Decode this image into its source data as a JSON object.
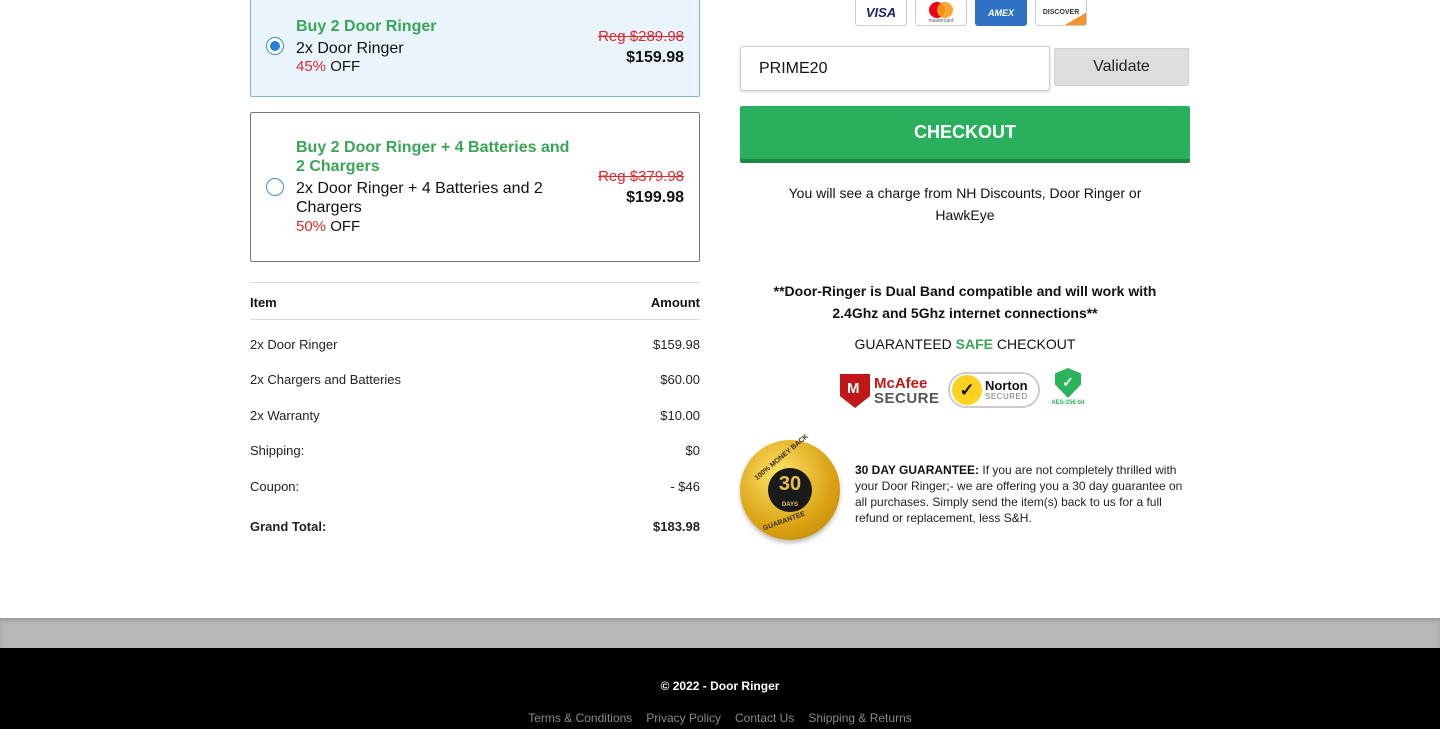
{
  "offers": [
    {
      "title": "Buy 2 Door Ringer",
      "subtitle": "2x Door Ringer",
      "discount_pct": "45%",
      "discount_word": " OFF",
      "reg_price": "Reg $289.98",
      "price": "$159.98",
      "selected": true
    },
    {
      "title": "Buy 2 Door Ringer + 4 Batteries and 2 Chargers",
      "subtitle": "2x Door Ringer + 4 Batteries and 2 Chargers",
      "discount_pct": "50%",
      "discount_word": " OFF",
      "reg_price": "Reg $379.98",
      "price": "$199.98",
      "selected": false
    }
  ],
  "summary": {
    "col_item": "Item",
    "col_amount": "Amount",
    "rows": [
      {
        "label": "2x Door Ringer",
        "amount": "$159.98"
      },
      {
        "label": "2x Chargers and Batteries",
        "amount": "$60.00"
      },
      {
        "label": "2x Warranty",
        "amount": "$10.00"
      },
      {
        "label": "Shipping:",
        "amount": "$0"
      },
      {
        "label": "Coupon:",
        "amount": "- $46"
      }
    ],
    "total_label": "Grand Total:",
    "total_amount": "$183.98"
  },
  "payment_cards": {
    "visa": "VISA",
    "mastercard": "mastercard",
    "amex": "AMEX",
    "discover": "DISCOVER"
  },
  "coupon": {
    "value": "PRIME20",
    "validate_label": "Validate"
  },
  "checkout_label": "CHECKOUT",
  "charge_notice": "You will see a charge from NH Discounts, Door Ringer or HawkEye",
  "dual_band_notice": "**Door-Ringer is Dual Band compatible and will work with 2.4Ghz and 5Ghz internet connections**",
  "safe_checkout": {
    "pre": "GUARANTEED ",
    "highlight": "SAFE",
    "post": " CHECKOUT"
  },
  "trust_badges": {
    "mcafee_top": "McAfee",
    "mcafee_bottom": "SECURE",
    "norton_top": "Norton",
    "norton_bottom": "SECURED",
    "aes": "AES-256 bit"
  },
  "guarantee_seal": {
    "top": "100% MONEY BACK",
    "number": "30",
    "days": "DAYS",
    "bottom": "GUARANTEE"
  },
  "guarantee": {
    "heading": "30 DAY GUARANTEE:",
    "text": " If you are not completely thrilled with your Door Ringer;- we are offering you a 30 day guarantee on all purchases. Simply send the item(s) back to us for a full refund or replacement, less S&H."
  },
  "footer": {
    "copyright": "© 2022 - Door Ringer",
    "links": [
      "Terms & Conditions",
      "Privacy Policy",
      "Contact Us",
      "Shipping & Returns"
    ]
  },
  "colors": {
    "accent_green": "#2aaf5c",
    "discount_red": "#e0282d",
    "selected_bg": "#e9f4fc"
  }
}
